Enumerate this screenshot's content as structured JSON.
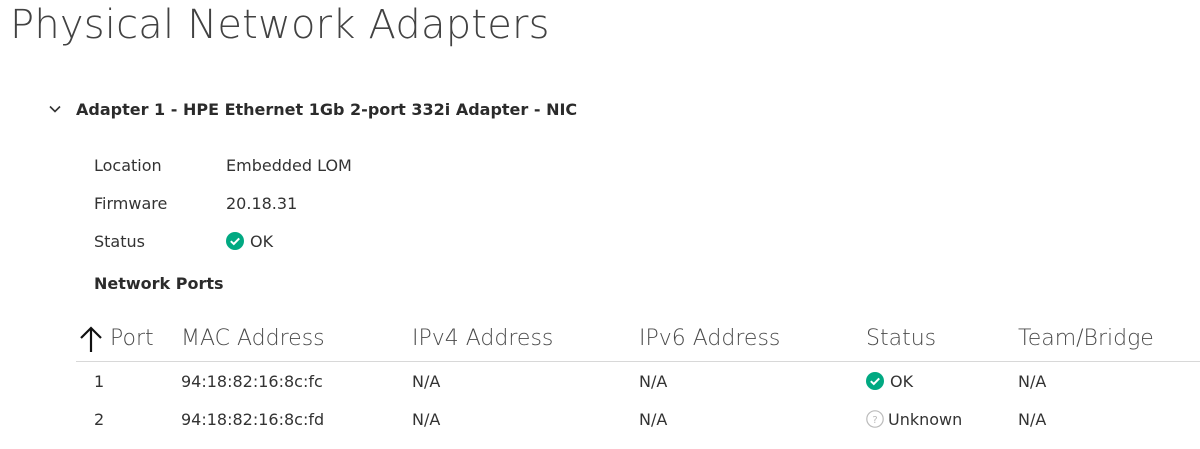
{
  "page": {
    "title": "Physical Network Adapters"
  },
  "adapter": {
    "title": "Adapter 1 - HPE Ethernet 1Gb 2-port 332i Adapter - NIC",
    "details": [
      {
        "label": "Location",
        "value": "Embedded LOM"
      },
      {
        "label": "Firmware",
        "value": "20.18.31"
      },
      {
        "label": "Status",
        "value": "OK",
        "status_icon": "check-circle-icon"
      }
    ],
    "network_ports_title": "Network Ports"
  },
  "ports_table": {
    "columns": [
      "Port",
      "MAC Address",
      "IPv4 Address",
      "IPv6 Address",
      "Status",
      "Team/Bridge"
    ],
    "sort_icon": "arrow-up-icon",
    "rows": [
      {
        "port": "1",
        "mac": "94:18:82:16:8c:fc",
        "ipv4": "N/A",
        "ipv6": "N/A",
        "status": "OK",
        "status_icon": "check-circle-icon",
        "team": "N/A"
      },
      {
        "port": "2",
        "mac": "94:18:82:16:8c:fd",
        "ipv4": "N/A",
        "ipv6": "N/A",
        "status": "Unknown",
        "status_icon": "question-circle-icon",
        "team": "N/A"
      }
    ]
  },
  "colors": {
    "ok_green": "#01a982",
    "unknown_gray": "#bbbbbb",
    "divider": "#d8d8d8"
  }
}
